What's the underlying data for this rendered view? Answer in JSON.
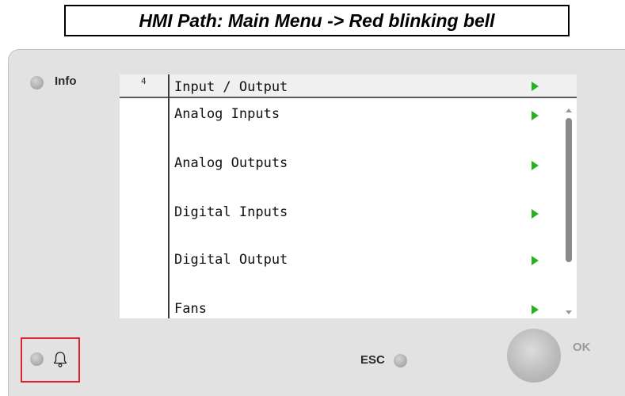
{
  "caption": "HMI Path: Main Menu -> Red blinking bell",
  "device": {
    "info_label": "Info",
    "esc_label": "ESC",
    "ok_label": "OK"
  },
  "screen": {
    "page_number": "4",
    "title": "Input / Output",
    "items": [
      {
        "label": "Analog Inputs"
      },
      {
        "label": "Analog Outputs"
      },
      {
        "label": "Digital Inputs"
      },
      {
        "label": "Digital Output"
      },
      {
        "label": "Fans"
      }
    ]
  },
  "colors": {
    "arrow": "#27b21f",
    "highlight_box": "#e02030"
  },
  "icons": {
    "alarm": "bell-icon",
    "submenu": "green-arrow-icon"
  }
}
